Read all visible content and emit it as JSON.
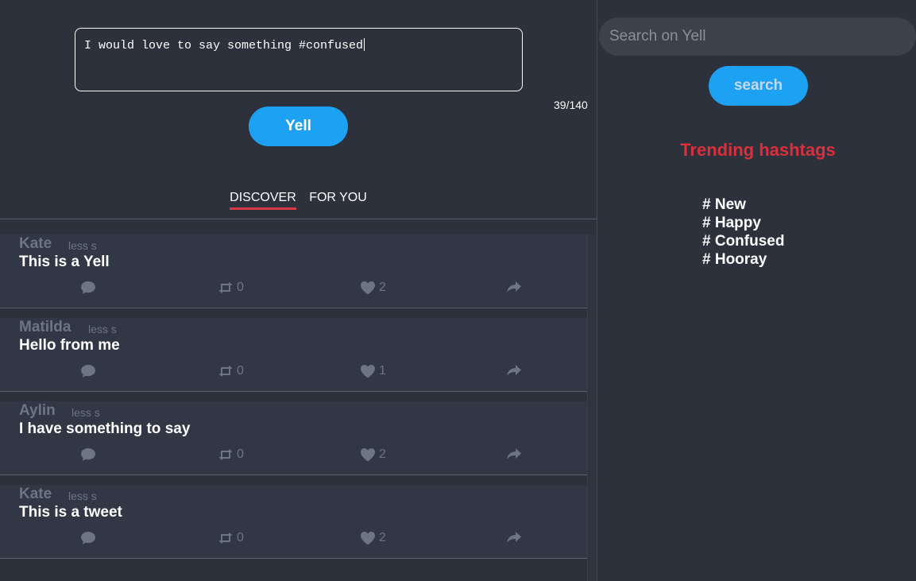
{
  "compose": {
    "text": "I would love to say something #confused",
    "char_count": "39/140",
    "yell_label": "Yell"
  },
  "tabs": [
    {
      "label": "DISCOVER",
      "active": true
    },
    {
      "label": "FOR YOU",
      "active": false
    }
  ],
  "feed": [
    {
      "user": "Kate",
      "time": "less s",
      "text": "This is a Yell",
      "retweets": "0",
      "likes": "2"
    },
    {
      "user": "Matilda",
      "time": "less s",
      "text": "Hello from me",
      "retweets": "0",
      "likes": "1"
    },
    {
      "user": "Aylin",
      "time": "less s",
      "text": "I have something to say",
      "retweets": "0",
      "likes": "2"
    },
    {
      "user": "Kate",
      "time": "less s",
      "text": "This is a tweet",
      "retweets": "0",
      "likes": "2"
    }
  ],
  "search": {
    "placeholder": "Search on Yell",
    "button_label": "search"
  },
  "trending": {
    "title": "Trending hashtags",
    "hashtags": [
      "# New",
      "# Happy",
      "# Confused",
      "# Hooray"
    ]
  },
  "icons": {
    "reply": "comment-icon",
    "retweet": "retweet-icon",
    "like": "heart-icon",
    "share": "share-icon"
  },
  "colors": {
    "background": "#2d313b",
    "accent": "#1da1f2",
    "trending_title": "#d8303d",
    "muted": "#6b7585"
  }
}
